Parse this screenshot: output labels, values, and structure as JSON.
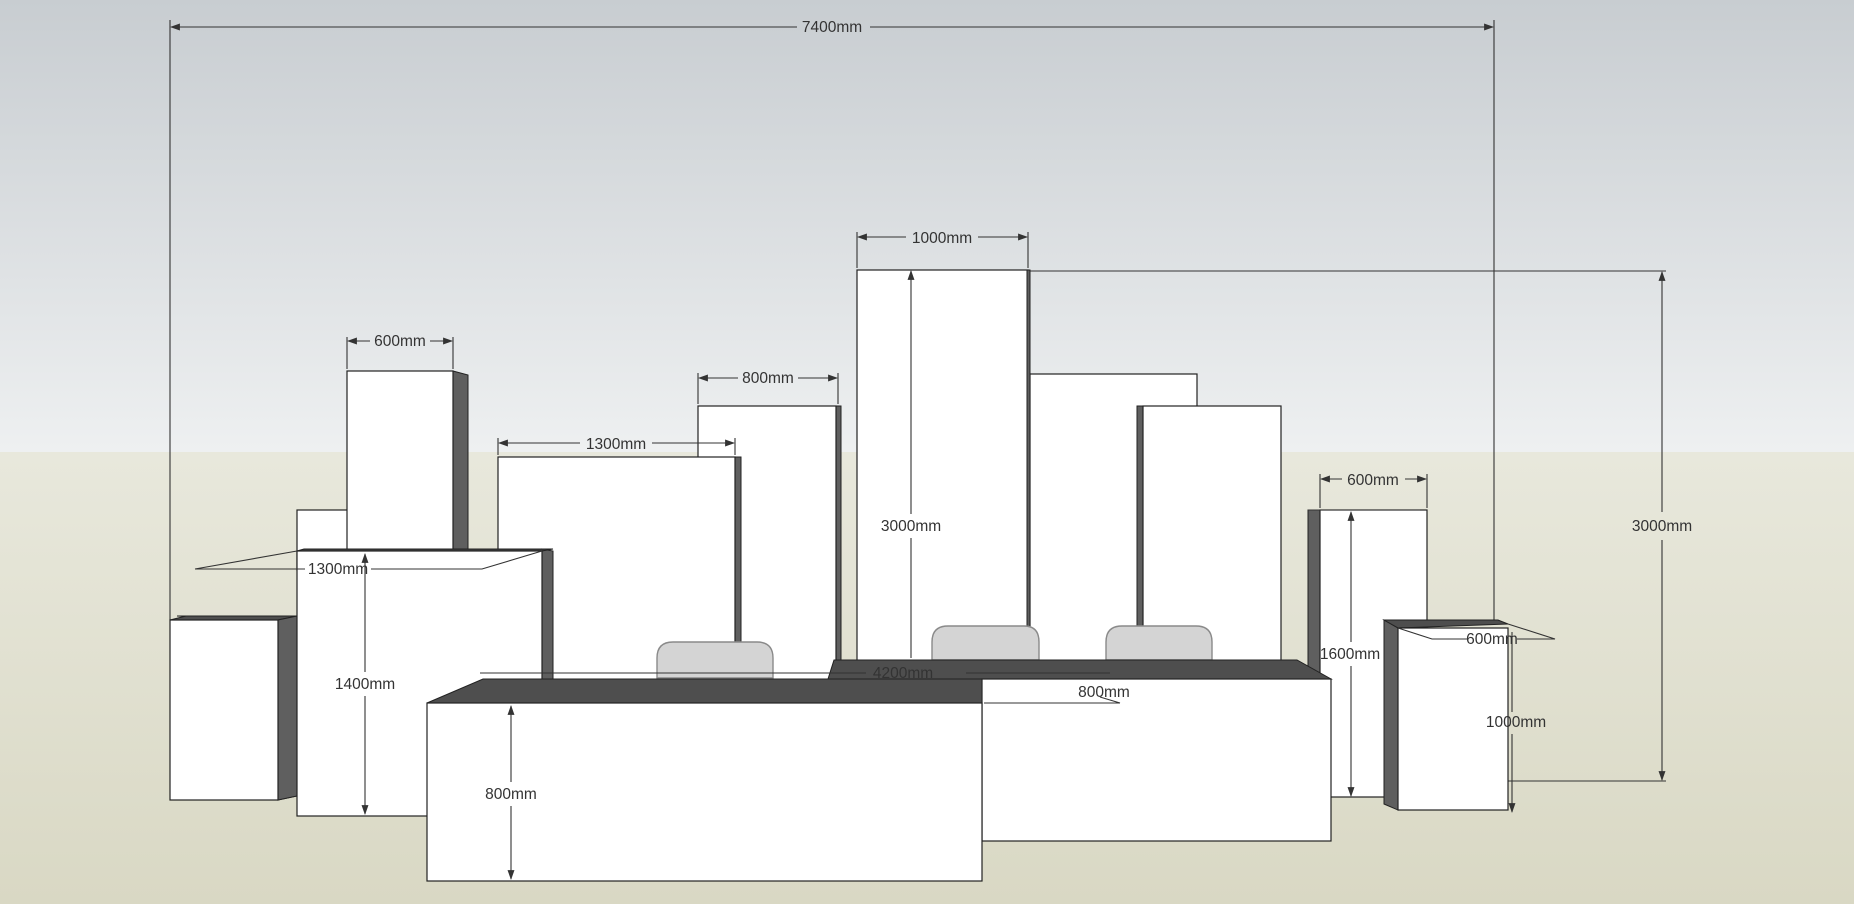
{
  "dimensions": {
    "overall_width": "7400mm",
    "tall_panel_width": "1000mm",
    "tall_panel_height": "3000mm",
    "right_total_height": "3000mm",
    "left_tower_width": "600mm",
    "mid_panel_width": "800mm",
    "left_panel_width": "1300mm",
    "cabinet_depth": "1300mm",
    "cabinet_height": "1400mm",
    "right_column_width": "600mm",
    "right_column_height": "1600mm",
    "right_cube_depth": "600mm",
    "right_cube_height": "1000mm",
    "counter_length": "4200mm",
    "counter_depth": "800mm",
    "counter_height": "800mm"
  },
  "colors": {
    "sky_top": "#c8cdd1",
    "sky_bottom": "#eef0f1",
    "ground_top": "#e8e8dc",
    "ground_bottom": "#d9d8c4",
    "dark_face": "#5f5f5f",
    "cushion": "#d4d4d4"
  }
}
